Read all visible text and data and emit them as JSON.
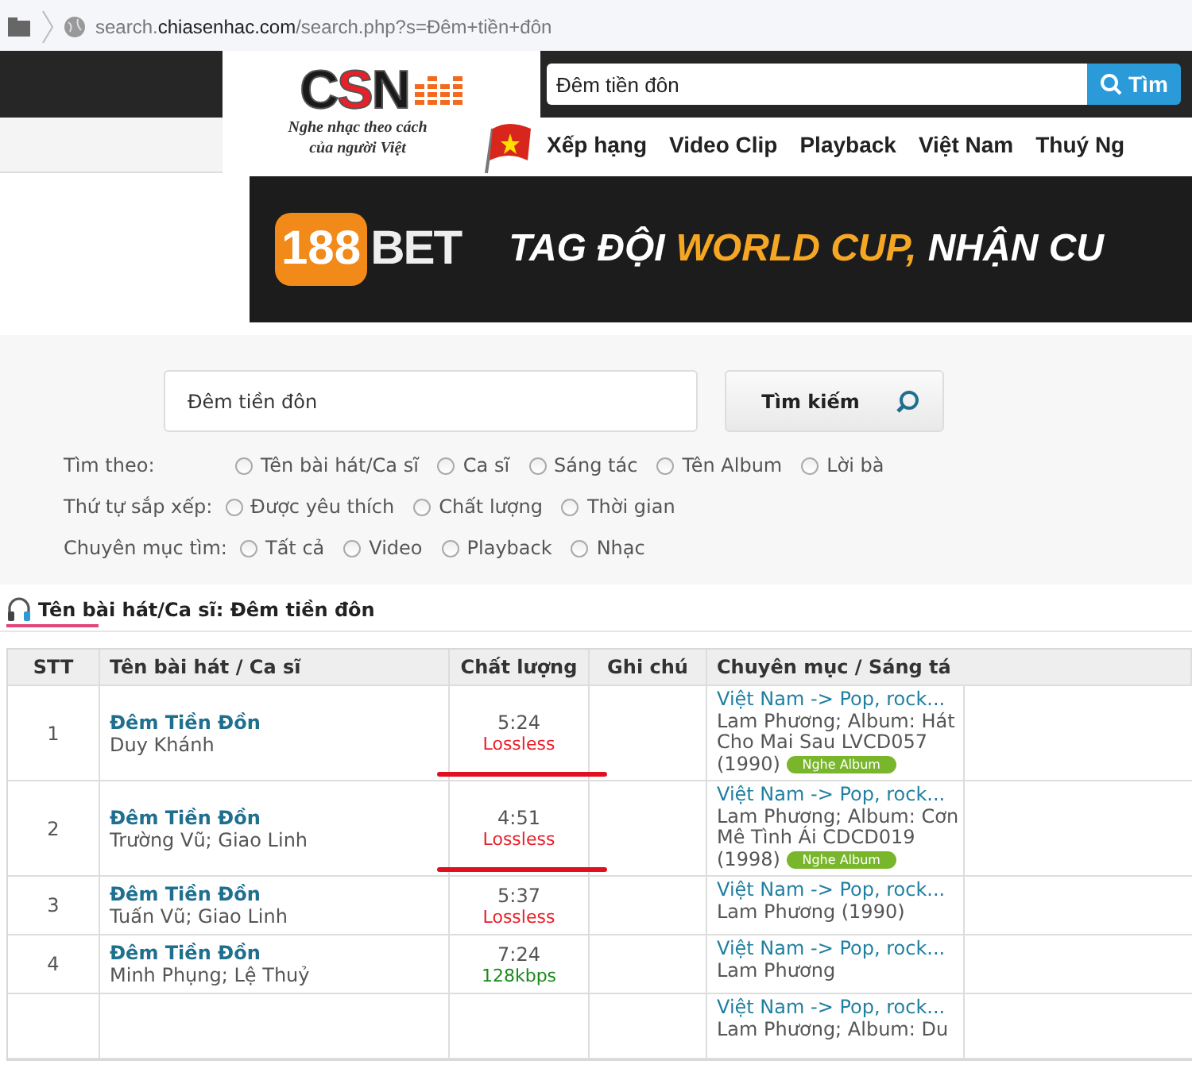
{
  "browser": {
    "url": "search.**chiasenhac.com**/search.php?s=Đêm+tiền+đôn"
  },
  "header": {
    "logo": {
      "letters": [
        {
          "text": "C",
          "color": "#1a1a1a"
        },
        {
          "text": "S",
          "color": "#e8202a"
        },
        {
          "text": "N",
          "color": "#1a1a1a"
        }
      ],
      "tagline": [
        "Nghe nhạc theo cách",
        "của người Việt"
      ]
    },
    "search": {
      "value": "Đêm tiền đôn",
      "button": "Tìm"
    },
    "nav": [
      "Xếp hạng",
      "Video Clip",
      "Playback",
      "Việt Nam",
      "Thuý Ng"
    ]
  },
  "banner": {
    "brand_number": "188",
    "brand_word": "BET",
    "headline": [
      {
        "text": "TAG ĐỘI",
        "color": "#ffffff"
      },
      {
        "text": "WORLD CUP,",
        "color": "#f5a623"
      },
      {
        "text": "NHẬN CU",
        "color": "#ffffff"
      }
    ]
  },
  "search_panel": {
    "query": "Đêm tiền đôn",
    "button": "Tìm kiếm",
    "option_groups": [
      {
        "label": "Tìm theo:",
        "options": [
          {
            "label": "Tên bài hát/Ca sĩ",
            "selected": false
          },
          {
            "label": "Ca sĩ",
            "selected": false
          },
          {
            "label": "Sáng tác",
            "selected": false
          },
          {
            "label": "Tên Album",
            "selected": false
          },
          {
            "label": "Lời bà",
            "selected": false
          }
        ]
      },
      {
        "label": "Thứ tự sắp xếp:",
        "options": [
          {
            "label": "Được yêu thích",
            "selected": false
          },
          {
            "label": "Chất lượng",
            "selected": false
          },
          {
            "label": "Thời gian",
            "selected": false
          }
        ]
      },
      {
        "label": "Chuyên mục tìm:",
        "options": [
          {
            "label": "Tất cả",
            "selected": false
          },
          {
            "label": "Video",
            "selected": false
          },
          {
            "label": "Playback",
            "selected": false
          },
          {
            "label": "Nhạc",
            "selected": false
          }
        ]
      }
    ]
  },
  "results": {
    "tab": {
      "label": "Tên bài hát/Ca sĩ: Đêm tiền đôn",
      "selected": true
    },
    "columns": [
      "STT",
      "Tên bài hát / Ca sĩ",
      "Chất lượng",
      "Ghi chú",
      "Chuyên mục / Sáng tá"
    ],
    "rows": [
      {
        "index": "1",
        "title": "Đêm Tiền Đồn",
        "artist": "Duy Khánh",
        "duration": "5:24",
        "quality": "Lossless",
        "color": "#e8202a",
        "marked": true,
        "category": "Việt Nam -> Pop, rock...",
        "details": "Lam Phương; Album: Hát Cho Mai Sau LVCD057 (1990)",
        "album_button": "Nghe Album"
      },
      {
        "index": "2",
        "title": "Đêm Tiền Đồn",
        "artist": "Trường Vũ; Giao Linh",
        "duration": "4:51",
        "quality": "Lossless",
        "color": "#e8202a",
        "marked": true,
        "category": "Việt Nam -> Pop, rock...",
        "details": "Lam Phương; Album: Cơn Mê Tình Ái CDCD019 (1998)",
        "album_button": "Nghe Album"
      },
      {
        "index": "3",
        "title": "Đêm Tiền Đồn",
        "artist": "Tuấn Vũ; Giao Linh",
        "duration": "5:37",
        "quality": "Lossless",
        "color": "#e8202a",
        "marked": false,
        "category": "Việt Nam -> Pop, rock...",
        "details": "Lam Phương (1990)"
      },
      {
        "index": "4",
        "title": "Đêm Tiền Đồn",
        "artist": "Minh Phụng; Lệ Thuỷ",
        "duration": "7:24",
        "quality": "128kbps",
        "color": "#1a8a1a",
        "marked": false,
        "category": "Việt Nam -> Pop, rock...",
        "details": "Lam Phương"
      },
      {
        "category": "Việt Nam -> Pop, rock...",
        "details": "Lam Phương; Album: Du",
        "marked": false
      }
    ]
  }
}
